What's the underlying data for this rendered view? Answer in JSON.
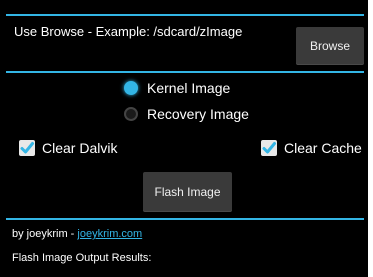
{
  "browse": {
    "hint": "Use Browse - Example: /sdcard/zImage",
    "button_label": "Browse"
  },
  "image_type": {
    "options": [
      {
        "label": "Kernel Image",
        "selected": true
      },
      {
        "label": "Recovery Image",
        "selected": false
      }
    ]
  },
  "options": {
    "clear_dalvik": {
      "label": "Clear Dalvik",
      "checked": true
    },
    "clear_cache": {
      "label": "Clear Cache",
      "checked": true
    }
  },
  "flash": {
    "button_label": "Flash Image"
  },
  "footer": {
    "credit_prefix": "by joeykrim - ",
    "credit_link": "joeykrim.com",
    "results_label": "Flash Image Output Results:"
  },
  "colors": {
    "accent": "#33b5e5",
    "background": "#000000",
    "button": "#3a3a3a"
  }
}
